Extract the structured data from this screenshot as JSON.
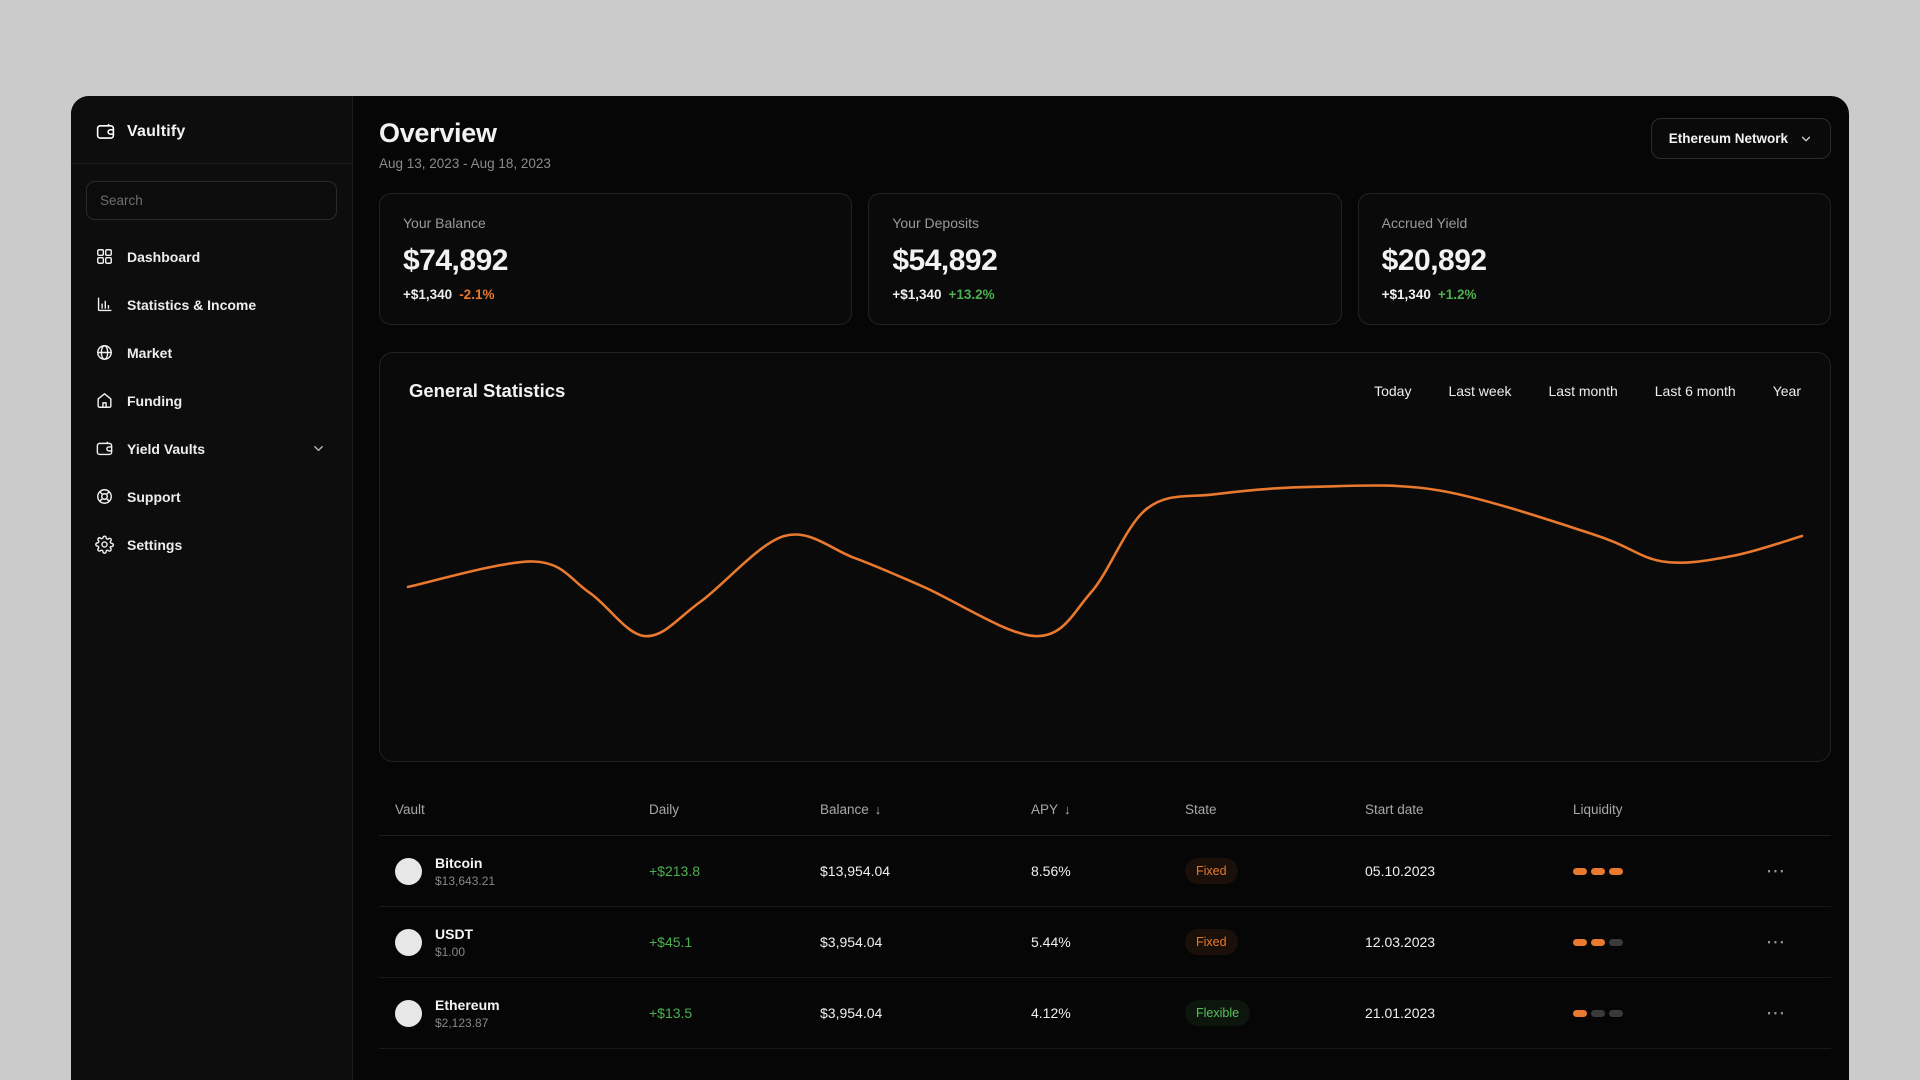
{
  "app_name": "Vaultify",
  "colors": {
    "outer_background": "#cbcbcb",
    "app_background": "#060606",
    "accent_orange": "#e8792e",
    "positive_green": "#4caf50",
    "negative_orange": "#e8792e"
  },
  "icons": {
    "more": "⋯",
    "sort_down": "↓"
  },
  "sidebar": {
    "logo": {
      "label": "Vaultify",
      "icon": "wallet-icon"
    },
    "search": {
      "placeholder": "Search"
    },
    "items": [
      {
        "label": "Dashboard",
        "icon": "dashboard-grid-icon"
      },
      {
        "label": "Statistics & Income",
        "icon": "bar-chart-icon"
      },
      {
        "label": "Market",
        "icon": "globe-icon"
      },
      {
        "label": "Funding",
        "icon": "home-icon"
      },
      {
        "label": "Yield Vaults",
        "icon": "wallet-icon",
        "has_chevron": true
      },
      {
        "label": "Support",
        "icon": "lifebuoy-icon"
      },
      {
        "label": "Settings",
        "icon": "gear-icon"
      }
    ]
  },
  "header": {
    "title": "Overview",
    "date_range": "Aug 13, 2023 - Aug 18, 2023",
    "network_selector": {
      "label": "Ethereum Network",
      "icon": "chevron-down-icon"
    }
  },
  "stat_cards": [
    {
      "label": "Your Balance",
      "value": "$74,892",
      "change_amount": "+$1,340",
      "change_percent": "-2.1%",
      "change_color": "#e8792e"
    },
    {
      "label": "Your Deposits",
      "value": "$54,892",
      "change_amount": "+$1,340",
      "change_percent": "+13.2%",
      "change_color": "#4caf50"
    },
    {
      "label": "Accrued Yield",
      "value": "$20,892",
      "change_amount": "+$1,340",
      "change_percent": "+1.2%",
      "change_color": "#4caf50"
    }
  ],
  "statistics_panel": {
    "title": "General Statistics",
    "filters": [
      "Today",
      "Last week",
      "Last month",
      "Last 6 month",
      "Year"
    ]
  },
  "chart_data": {
    "type": "line",
    "title": "General Statistics",
    "line_color": "#e8792e",
    "grid": false,
    "axes_labeled": false,
    "note": "No axis ticks or labels visible; values are relative heights (0-100) read from pixel positions",
    "x_percent": [
      0,
      9,
      13,
      17,
      21,
      27,
      32,
      37,
      45,
      49,
      53,
      58,
      65,
      74,
      85,
      90,
      95,
      100
    ],
    "values": [
      33,
      47,
      30,
      6,
      25,
      61,
      49,
      33,
      6,
      30,
      76,
      84,
      88,
      86,
      62,
      47,
      50,
      61
    ]
  },
  "table": {
    "columns": [
      {
        "label": "Vault",
        "sortable": false
      },
      {
        "label": "Daily",
        "sortable": false
      },
      {
        "label": "Balance",
        "sortable": true
      },
      {
        "label": "APY",
        "sortable": true
      },
      {
        "label": "State",
        "sortable": false
      },
      {
        "label": "Start date",
        "sortable": false
      },
      {
        "label": "Liquidity",
        "sortable": false
      }
    ],
    "rows": [
      {
        "name": "Bitcoin",
        "price": "$13,643.21",
        "daily": "+$213.8",
        "balance": "$13,954.04",
        "apy": "8.56%",
        "state": "Fixed",
        "start_date": "05.10.2023",
        "liquidity_level": 3,
        "liquidity_max": 3
      },
      {
        "name": "USDT",
        "price": "$1.00",
        "daily": "+$45.1",
        "balance": "$3,954.04",
        "apy": "5.44%",
        "state": "Fixed",
        "start_date": "12.03.2023",
        "liquidity_level": 2,
        "liquidity_max": 3
      },
      {
        "name": "Ethereum",
        "price": "$2,123.87",
        "daily": "+$13.5",
        "balance": "$3,954.04",
        "apy": "4.12%",
        "state": "Flexible",
        "start_date": "21.01.2023",
        "liquidity_level": 1,
        "liquidity_max": 3
      }
    ]
  }
}
